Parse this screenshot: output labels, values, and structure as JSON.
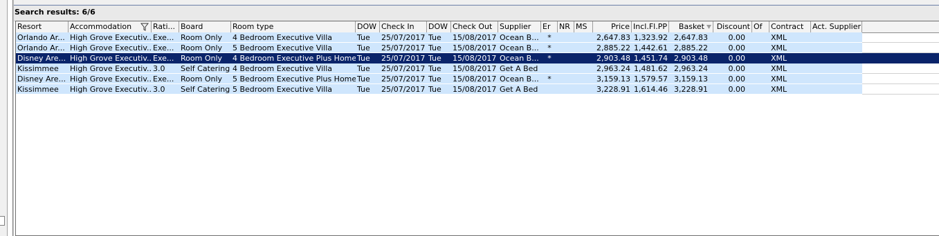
{
  "title": "Search results: 6/6",
  "columns": [
    {
      "key": "resort",
      "label": "Resort"
    },
    {
      "key": "accommodation",
      "label": "Accommodation",
      "icon": "filter-icon"
    },
    {
      "key": "rating",
      "label": "Rati..."
    },
    {
      "key": "board",
      "label": "Board"
    },
    {
      "key": "room_type",
      "label": "Room type"
    },
    {
      "key": "dow_in",
      "label": "DOW"
    },
    {
      "key": "check_in",
      "label": "Check In"
    },
    {
      "key": "dow_out",
      "label": "DOW"
    },
    {
      "key": "check_out",
      "label": "Check Out"
    },
    {
      "key": "supplier",
      "label": "Supplier"
    },
    {
      "key": "er",
      "label": "Er"
    },
    {
      "key": "nr",
      "label": "NR"
    },
    {
      "key": "ms",
      "label": "MS"
    },
    {
      "key": "price",
      "label": "Price"
    },
    {
      "key": "incl_fl_pp",
      "label": "Incl.Fl.PP"
    },
    {
      "key": "basket",
      "label": "Basket",
      "icon": "sort-descending-icon"
    },
    {
      "key": "discount",
      "label": "Discount"
    },
    {
      "key": "of",
      "label": "Of"
    },
    {
      "key": "contract",
      "label": "Contract"
    },
    {
      "key": "act_supplier",
      "label": "Act. Supplier"
    }
  ],
  "rows": [
    {
      "resort": "Orlando Ar...",
      "accommodation": "High Grove Executiv...",
      "rating": "Exe...",
      "board": "Room Only",
      "room_type": "4 Bedroom Executive Villa",
      "dow_in": "Tue",
      "check_in": "25/07/2017",
      "dow_out": "Tue",
      "check_out": "15/08/2017",
      "supplier": "Ocean B...",
      "er": "*",
      "nr": "",
      "ms": "",
      "price": "2,647.83",
      "incl_fl_pp": "1,323.92",
      "basket": "2,647.83",
      "discount": "0.00",
      "of": "",
      "contract": "XML",
      "act_supplier": "",
      "selected": false
    },
    {
      "resort": "Orlando Ar...",
      "accommodation": "High Grove Executiv...",
      "rating": "Exe...",
      "board": "Room Only",
      "room_type": "5 Bedroom Executive Villa",
      "dow_in": "Tue",
      "check_in": "25/07/2017",
      "dow_out": "Tue",
      "check_out": "15/08/2017",
      "supplier": "Ocean B...",
      "er": "*",
      "nr": "",
      "ms": "",
      "price": "2,885.22",
      "incl_fl_pp": "1,442.61",
      "basket": "2,885.22",
      "discount": "0.00",
      "of": "",
      "contract": "XML",
      "act_supplier": "",
      "selected": false
    },
    {
      "resort": "Disney Are...",
      "accommodation": "High Grove Executiv...",
      "rating": "Exe...",
      "board": "Room Only",
      "room_type": "4 Bedroom Executive Plus Home",
      "dow_in": "Tue",
      "check_in": "25/07/2017",
      "dow_out": "Tue",
      "check_out": "15/08/2017",
      "supplier": "Ocean B...",
      "er": "*",
      "nr": "",
      "ms": "",
      "price": "2,903.48",
      "incl_fl_pp": "1,451.74",
      "basket": "2,903.48",
      "discount": "0.00",
      "of": "",
      "contract": "XML",
      "act_supplier": "",
      "selected": true
    },
    {
      "resort": "Kissimmee",
      "accommodation": "High Grove Executiv...",
      "rating": "3.0",
      "board": "Self Catering",
      "room_type": "4 Bedroom Executive Villa",
      "dow_in": "Tue",
      "check_in": "25/07/2017",
      "dow_out": "Tue",
      "check_out": "15/08/2017",
      "supplier": "Get A Bed",
      "er": "",
      "nr": "",
      "ms": "",
      "price": "2,963.24",
      "incl_fl_pp": "1,481.62",
      "basket": "2,963.24",
      "discount": "0.00",
      "of": "",
      "contract": "XML",
      "act_supplier": "",
      "selected": false
    },
    {
      "resort": "Disney Are...",
      "accommodation": "High Grove Executiv...",
      "rating": "Exe...",
      "board": "Room Only",
      "room_type": "5 Bedroom Executive Plus Home",
      "dow_in": "Tue",
      "check_in": "25/07/2017",
      "dow_out": "Tue",
      "check_out": "15/08/2017",
      "supplier": "Ocean B...",
      "er": "*",
      "nr": "",
      "ms": "",
      "price": "3,159.13",
      "incl_fl_pp": "1,579.57",
      "basket": "3,159.13",
      "discount": "0.00",
      "of": "",
      "contract": "XML",
      "act_supplier": "",
      "selected": false
    },
    {
      "resort": "Kissimmee",
      "accommodation": "High Grove Executiv...",
      "rating": "3.0",
      "board": "Self Catering",
      "room_type": "5 Bedroom Executive Villa",
      "dow_in": "Tue",
      "check_in": "25/07/2017",
      "dow_out": "Tue",
      "check_out": "15/08/2017",
      "supplier": "Get A Bed",
      "er": "",
      "nr": "",
      "ms": "",
      "price": "3,228.91",
      "incl_fl_pp": "1,614.46",
      "basket": "3,228.91",
      "discount": "0.00",
      "of": "",
      "contract": "XML",
      "act_supplier": "",
      "selected": false
    }
  ],
  "colors": {
    "row_bg": "#cfe6fd",
    "selected_bg": "#0a246a",
    "selected_text": "#ffffff",
    "header_bg": "#f3f3f3"
  }
}
